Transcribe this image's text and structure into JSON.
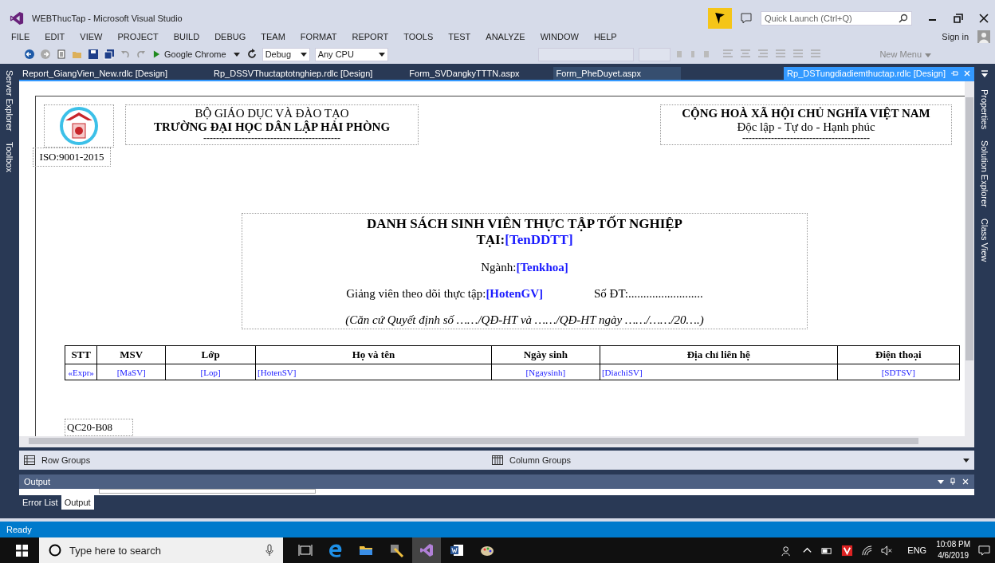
{
  "window": {
    "title": "WEBThucTap - Microsoft Visual Studio"
  },
  "quick_launch": {
    "placeholder": "Quick Launch (Ctrl+Q)"
  },
  "menu": [
    "FILE",
    "EDIT",
    "VIEW",
    "PROJECT",
    "BUILD",
    "DEBUG",
    "TEAM",
    "FORMAT",
    "REPORT",
    "TOOLS",
    "TEST",
    "ANALYZE",
    "WINDOW",
    "HELP"
  ],
  "sign_in": "Sign in",
  "toolbar": {
    "run_target": "Google Chrome",
    "configuration": "Debug",
    "platform": "Any CPU",
    "new_menu": "New Menu"
  },
  "doc_tabs": [
    {
      "label": "Report_GiangVien_New.rdlc [Design]",
      "selected": false
    },
    {
      "label": "Rp_DSSVThuctaptotnghiep.rdlc [Design]",
      "selected": false
    },
    {
      "label": "Form_SVDangkyTTTN.aspx",
      "selected": false
    },
    {
      "label": "Form_PheDuyet.aspx",
      "selected": false
    },
    {
      "label": "Rp_DSTungdiadiemthuctap.rdlc [Design]",
      "selected": true
    }
  ],
  "left_side_tabs": [
    "Server Explorer",
    "Toolbox"
  ],
  "right_side_tabs": [
    "Properties",
    "Solution Explorer",
    "Class View"
  ],
  "report": {
    "iso": "ISO:9001-2015",
    "header_left": {
      "line1": "BỘ GIÁO DỤC VÀ ĐÀO TẠO",
      "line2": "TRƯỜNG ĐẠI HỌC DÂN LẬP HẢI PHÒNG",
      "rule": "-------------------------------------------"
    },
    "header_right": {
      "line1": "CỘNG HOÀ XÃ HỘI CHỦ NGHĨA VIỆT NAM",
      "line2": "Độc lập - Tự do - Hạnh phúc",
      "rule": "----------------------------------------"
    },
    "title": "DANH SÁCH SINH VIÊN THỰC TẬP TỐT NGHIỆP",
    "at_label": "TẠI:",
    "at_field": "[TenDDTT]",
    "major_label": "Ngành:",
    "major_field": "[Tenkhoa]",
    "lecturer_label": "Giảng viên theo dõi thực tập:",
    "lecturer_field": "[HotenGV]",
    "phone": "Số ĐT:.........................",
    "note": "(Căn cứ Quyết định số ……/QĐ-HT và ……/QĐ-HT  ngày ……/……/20….)",
    "table": {
      "columns": [
        "STT",
        "MSV",
        "Lớp",
        "Họ và tên",
        "Ngày sinh",
        "Địa chỉ liên hệ",
        "Điện thoại"
      ],
      "rows": [
        [
          "«Expr»",
          "[MaSV]",
          "[Lop]",
          "[HotenSV]",
          "[Ngaysinh]",
          "[DiachiSV]",
          "[SDTSV]"
        ]
      ]
    },
    "footer": "QC20-B08"
  },
  "row_groups": "Row Groups",
  "column_groups": "Column Groups",
  "output_panel": {
    "title": "Output",
    "tabs": [
      {
        "label": "Error List",
        "selected": false
      },
      {
        "label": "Output",
        "selected": true
      }
    ]
  },
  "status_bar": "Ready",
  "taskbar": {
    "search_placeholder": "Type here to search",
    "language": "ENG",
    "time": "10:08 PM",
    "date": "4/6/2019"
  }
}
